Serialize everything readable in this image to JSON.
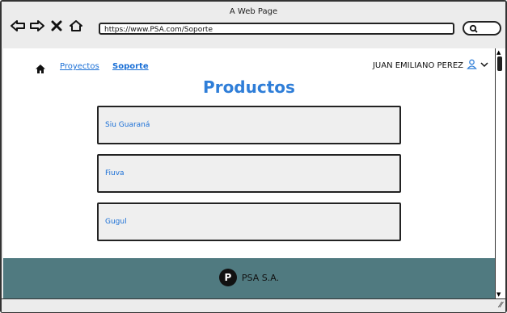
{
  "window": {
    "title": "A Web Page"
  },
  "browser": {
    "url": "https://www.PSA.com/Soporte",
    "icons": [
      "back-icon",
      "forward-icon",
      "close-icon",
      "home-icon",
      "search-icon"
    ]
  },
  "nav": {
    "links": [
      {
        "label": "Proyectos"
      },
      {
        "label": "Soporte"
      }
    ],
    "user": "JUAN EMILIANO PEREZ"
  },
  "page": {
    "title": "Productos",
    "products": [
      {
        "name": "Siu Guaraná"
      },
      {
        "name": "Fiuva"
      },
      {
        "name": "Gugul"
      }
    ]
  },
  "footer": {
    "logo_letter": "P",
    "brand": "PSA S.A."
  },
  "colors": {
    "accent": "#2f7ed8",
    "link": "#1a6fd6",
    "footer_bg": "#507a80"
  }
}
